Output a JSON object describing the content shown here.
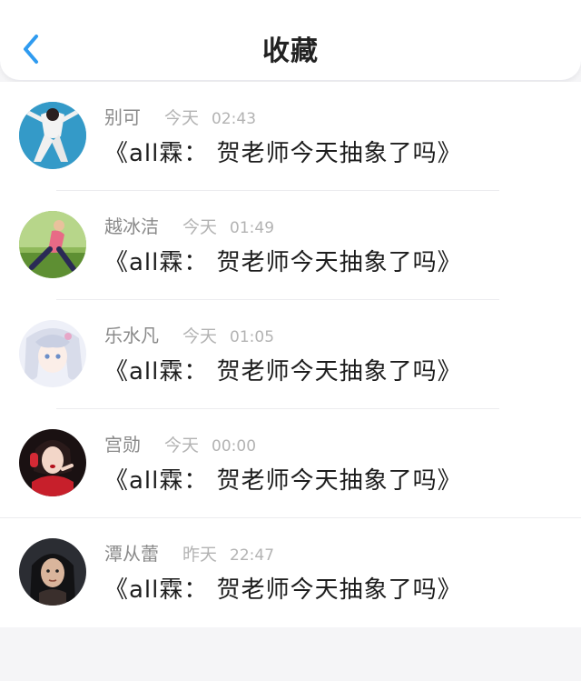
{
  "header": {
    "title": "收藏",
    "back_icon": "chevron-left-icon",
    "accent_color": "#2f9bf0"
  },
  "messages": [
    {
      "name": "别可",
      "day": "今天",
      "time": "02:43",
      "text": "《all霖： 贺老师今天抽象了吗》"
    },
    {
      "name": "越冰洁",
      "day": "今天",
      "time": "01:49",
      "text": "《all霖： 贺老师今天抽象了吗》"
    },
    {
      "name": "乐水凡",
      "day": "今天",
      "time": "01:05",
      "text": "《all霖： 贺老师今天抽象了吗》"
    },
    {
      "name": "宫勋",
      "day": "今天",
      "time": "00:00",
      "text": "《all霖： 贺老师今天抽象了吗》"
    },
    {
      "name": "潭从蕾",
      "day": "昨天",
      "time": "22:47",
      "text": "《all霖： 贺老师今天抽象了吗》"
    }
  ]
}
